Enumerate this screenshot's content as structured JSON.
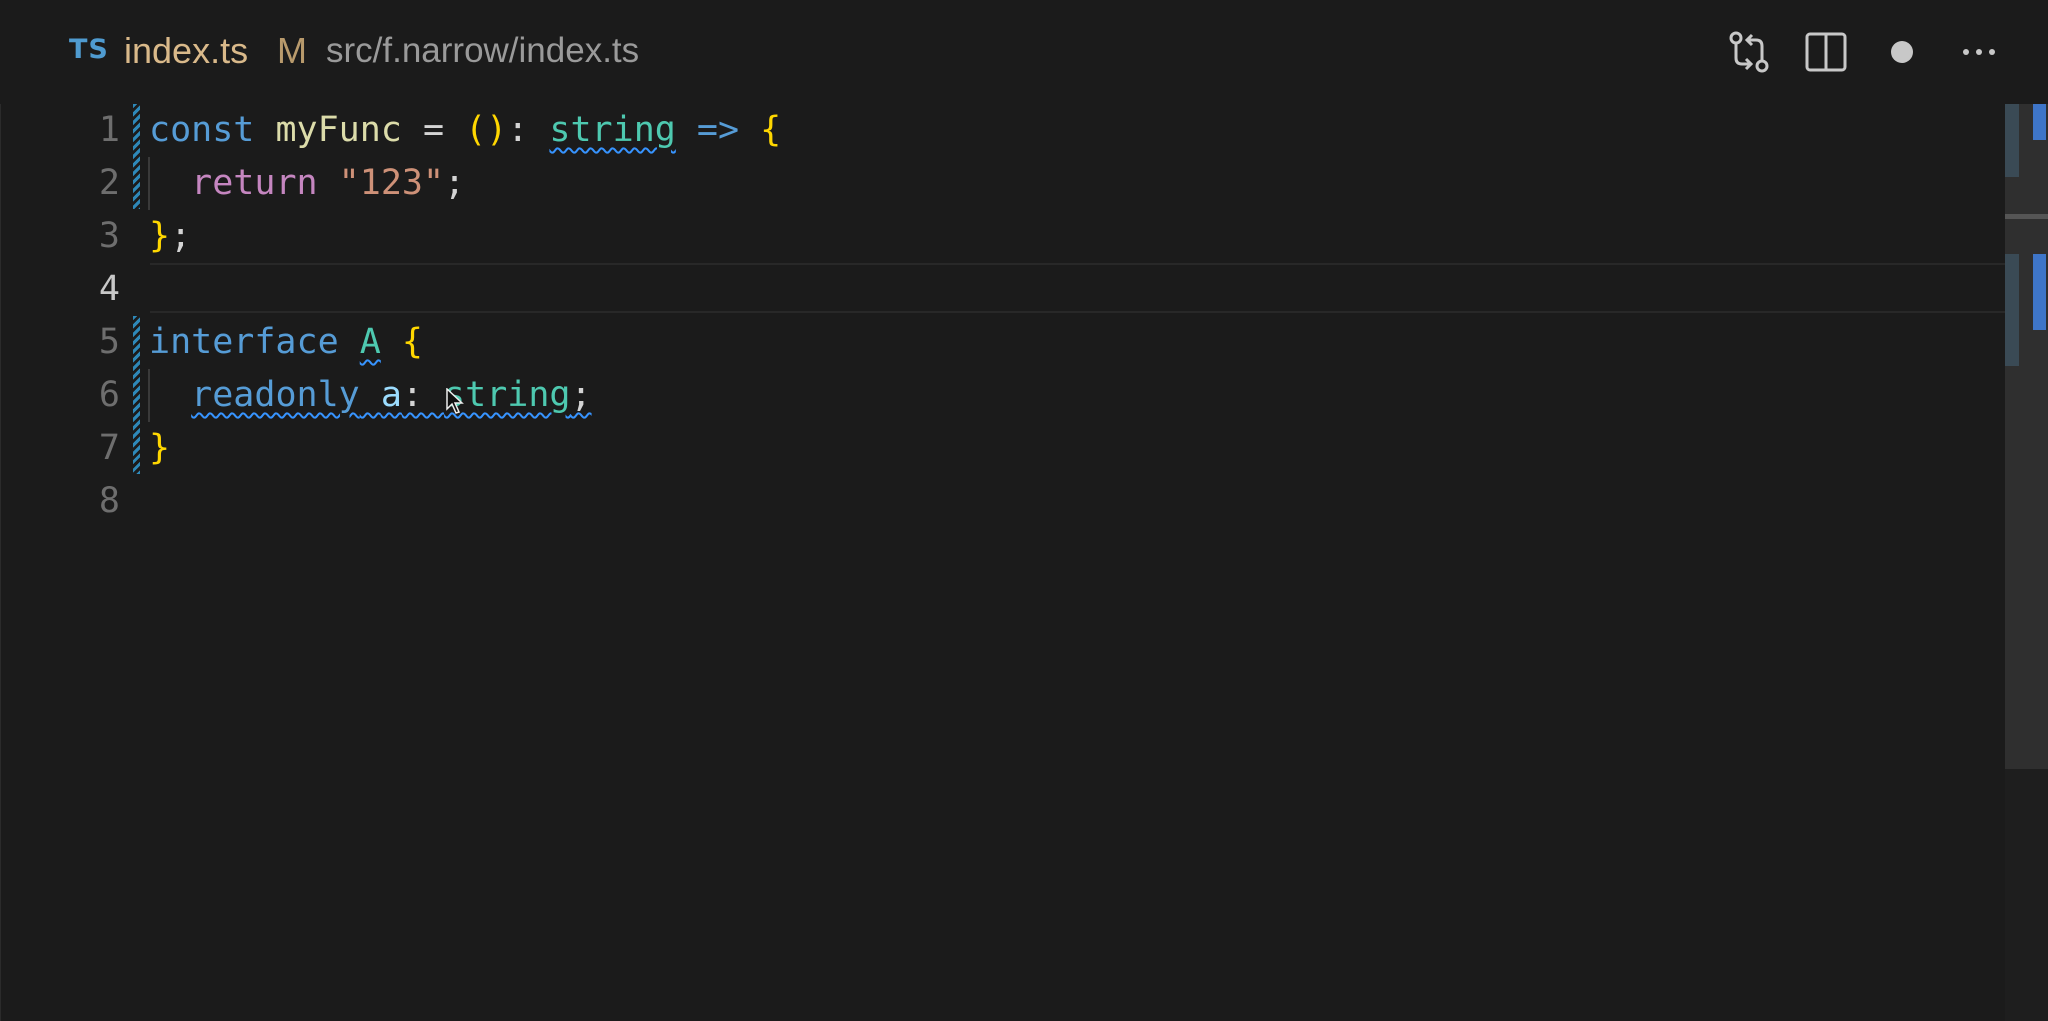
{
  "tab": {
    "language_badge": "TS",
    "file_name": "index.ts",
    "modified_flag": "M",
    "path": "src/f.narrow/index.ts"
  },
  "toolbar": {
    "actions": [
      {
        "name": "open-changes-icon"
      },
      {
        "name": "split-editor-icon"
      },
      {
        "name": "unsaved-dot-icon"
      },
      {
        "name": "more-actions-icon"
      }
    ]
  },
  "editor": {
    "line_numbers": [
      "1",
      "2",
      "3",
      "4",
      "5",
      "6",
      "7",
      "8"
    ],
    "active_line": "4",
    "code": {
      "l1": {
        "const": "const",
        "name": "myFunc",
        "eq": " = ",
        "parens": "()",
        "colon": ": ",
        "type": "string",
        "arrow": " => ",
        "brace": "{"
      },
      "l2": {
        "return": "return",
        "space": " ",
        "string": "\"123\"",
        "semi": ";"
      },
      "l3": {
        "brace": "}",
        "semi": ";"
      },
      "l5": {
        "interface": "interface",
        "space": " ",
        "name": "A",
        "space2": " ",
        "brace": "{"
      },
      "l6": {
        "readonly": "readonly",
        "space": " ",
        "prop": "a",
        "colon": ": ",
        "type": "string",
        "semi": ";"
      },
      "l7": {
        "brace": "}"
      }
    }
  },
  "colors": {
    "background": "#1b1b1b",
    "keyword": "#569cd6",
    "function": "#dcdcaa",
    "type": "#4ec9b0",
    "bracket": "#ffd700",
    "control": "#c586c0",
    "string": "#ce9178",
    "property": "#9cdcfe",
    "squiggle": "#3794ff"
  }
}
